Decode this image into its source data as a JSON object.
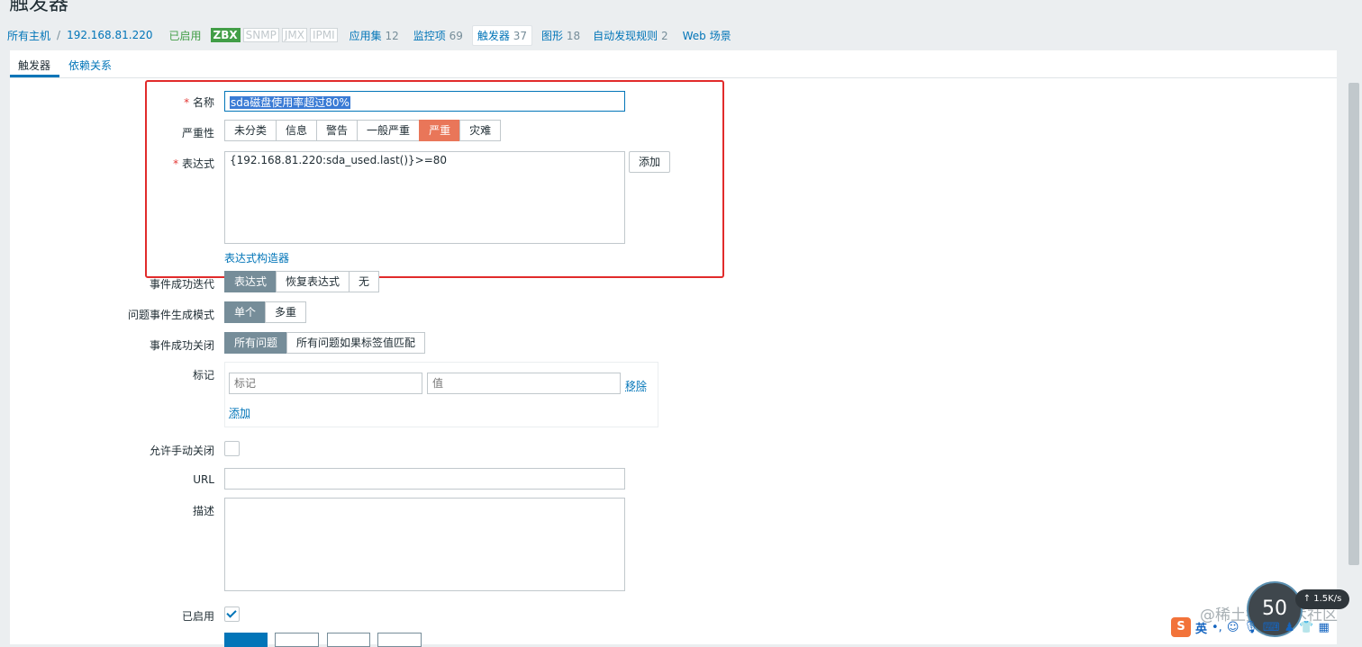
{
  "page_title": "触发器",
  "host_nav": {
    "all_hosts": "所有主机",
    "separator": "/",
    "host": "192.168.81.220",
    "status": "已启用",
    "availability": [
      "ZBX",
      "SNMP",
      "JMX",
      "IPMI"
    ],
    "applications": {
      "label": "应用集",
      "count": "12"
    },
    "items": {
      "label": "监控项",
      "count": "69"
    },
    "triggers": {
      "label": "触发器",
      "count": "37"
    },
    "graphs": {
      "label": "图形",
      "count": "18"
    },
    "discovery": {
      "label": "自动发现规则",
      "count": "2"
    },
    "web": "Web 场景"
  },
  "tabs": {
    "trigger": "触发器",
    "dependencies": "依赖关系"
  },
  "form": {
    "name": {
      "label": "名称",
      "value": "sda磁盘使用率超过80%"
    },
    "severity": {
      "label": "严重性",
      "options": [
        "未分类",
        "信息",
        "警告",
        "一般严重",
        "严重",
        "灾难"
      ],
      "selected": "严重"
    },
    "expression": {
      "label": "表达式",
      "value": "{192.168.81.220:sda_used.last()}>=80",
      "add_button": "添加",
      "constructor_link": "表达式构造器"
    },
    "ok_event_generation": {
      "label": "事件成功迭代",
      "options": [
        "表达式",
        "恢复表达式",
        "无"
      ],
      "selected": "表达式"
    },
    "problem_event_mode": {
      "label": "问题事件生成模式",
      "options": [
        "单个",
        "多重"
      ],
      "selected": "单个"
    },
    "ok_event_closes": {
      "label": "事件成功关闭",
      "options": [
        "所有问题",
        "所有问题如果标签值匹配"
      ],
      "selected": "所有问题"
    },
    "tags": {
      "label": "标记",
      "tag_placeholder": "标记",
      "value_placeholder": "值",
      "remove_link": "移除",
      "add_link": "添加"
    },
    "manual_close": {
      "label": "允许手动关闭",
      "checked": false
    },
    "url": {
      "label": "URL",
      "value": ""
    },
    "description": {
      "label": "描述",
      "value": ""
    },
    "enabled": {
      "label": "已启用",
      "checked": true
    }
  },
  "overlay": {
    "gauge_value": "50",
    "speed": "↑ 1.5K/s",
    "watermark": "@稀土掘金技术社区",
    "ime_logo": "S",
    "ime_lang": "英"
  },
  "colors": {
    "accent": "#0275b8",
    "severity_high": "#e97659",
    "annotation_box": "#e12b2b"
  }
}
